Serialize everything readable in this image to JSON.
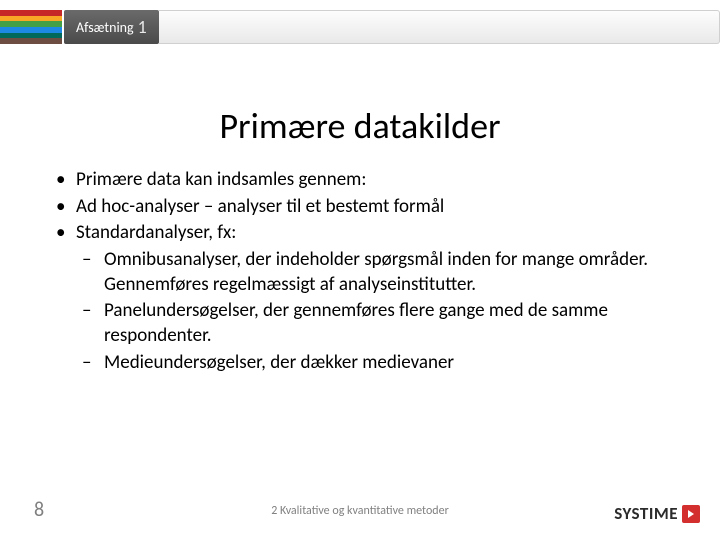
{
  "header": {
    "subject": "Afsætning",
    "number": "1"
  },
  "title": "Primære datakilder",
  "bullets": [
    {
      "text": "Primære data kan indsamles gennem:"
    },
    {
      "text": "Ad hoc-analyser – analyser til et bestemt formål"
    },
    {
      "text": "Standardanalyser, fx:",
      "children": [
        "Omnibusanalyser, der indeholder spørgsmål inden for mange områder. Gennemføres regelmæssigt af analyseinstitutter.",
        "Panelundersøgelser, der gennemføres flere gange med de samme respondenter.",
        "Medieundersøgelser, der dækker medievaner"
      ]
    }
  ],
  "footer": {
    "page": "8",
    "caption": "2 Kvalitative og kvantitative metoder",
    "logo": "SYSTIME"
  }
}
